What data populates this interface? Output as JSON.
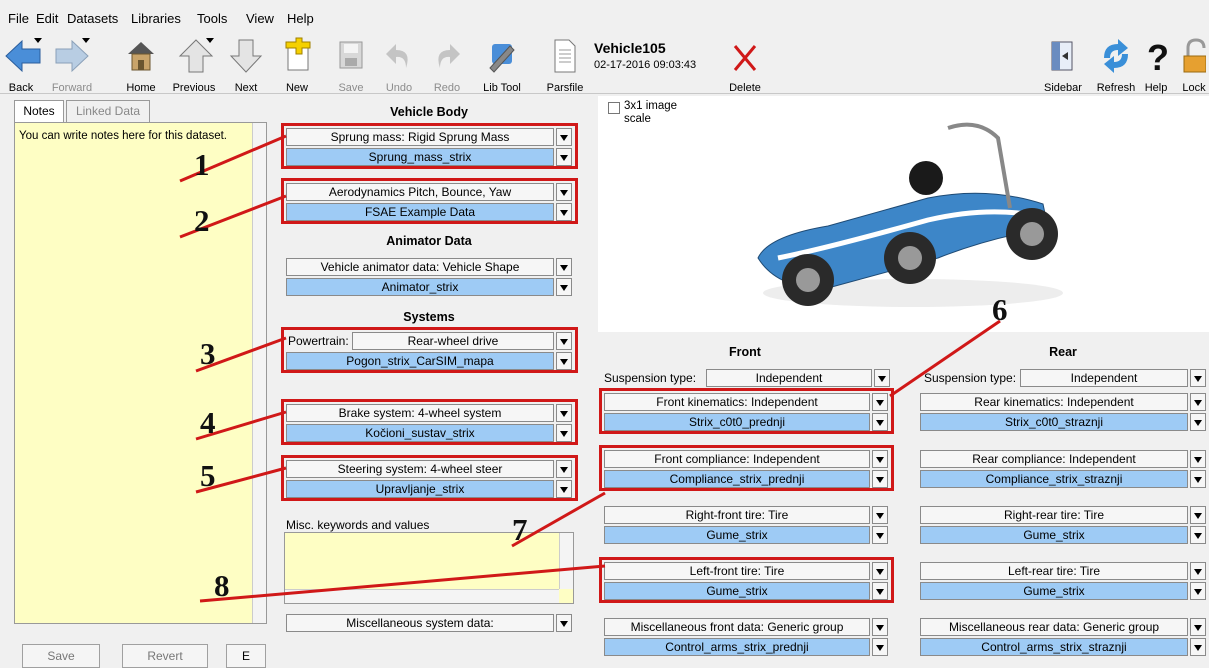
{
  "menu": [
    "File",
    "Edit",
    "Datasets",
    "Libraries",
    "Tools",
    "View",
    "Help"
  ],
  "toolbar": {
    "back": "Back",
    "forward": "Forward",
    "home": "Home",
    "previous": "Previous",
    "next": "Next",
    "new": "New",
    "save": "Save",
    "undo": "Undo",
    "redo": "Redo",
    "libtool": "Lib Tool",
    "parsfile": "Parsfile",
    "dataset_title": "Vehicle105",
    "dataset_date": "02-17-2016 09:03:43",
    "delete": "Delete",
    "sidebar": "Sidebar",
    "refresh": "Refresh",
    "help": "Help",
    "lock": "Lock"
  },
  "left": {
    "tab_notes": "Notes",
    "tab_linked": "Linked Data",
    "notes_text": "You can write notes here for this dataset.",
    "save": "Save",
    "revert": "Revert",
    "extra": "E"
  },
  "vehicle_body": {
    "title": "Vehicle Body",
    "sprung_label": "Sprung mass: Rigid Sprung Mass",
    "sprung_value": "Sprung_mass_strix",
    "aero_label": "Aerodynamics Pitch, Bounce, Yaw",
    "aero_value": "FSAE Example Data"
  },
  "animator": {
    "title": "Animator Data",
    "label": "Vehicle animator data: Vehicle Shape",
    "value": "Animator_strix"
  },
  "systems": {
    "title": "Systems",
    "powertrain_label": "Powertrain:",
    "powertrain_type": "Rear-wheel drive",
    "powertrain_value": "Pogon_strix_CarSIM_mapa",
    "brake_label": "Brake system: 4-wheel system",
    "brake_value": "Kočioni_sustav_strix",
    "steer_label": "Steering system: 4-wheel steer",
    "steer_value": "Upravljanje_strix",
    "misc_kw_label": "Misc. keywords and values",
    "misc_sys": "Miscellaneous system data:"
  },
  "image": {
    "checkbox_label": "3x1 image scale"
  },
  "front": {
    "title": "Front",
    "susp_label": "Suspension type:",
    "susp_type": "Independent",
    "kin_label": "Front kinematics: Independent",
    "kin_value": "Strix_c0t0_prednji",
    "comp_label": "Front compliance: Independent",
    "comp_value": "Compliance_strix_prednji",
    "rtire_label": "Right-front tire: Tire",
    "rtire_value": "Gume_strix",
    "ltire_label": "Left-front tire: Tire",
    "ltire_value": "Gume_strix",
    "misc_label": "Miscellaneous front data: Generic group",
    "misc_value": "Control_arms_strix_prednji"
  },
  "rear": {
    "title": "Rear",
    "susp_label": "Suspension type:",
    "susp_type": "Independent",
    "kin_label": "Rear kinematics: Independent",
    "kin_value": "Strix_c0t0_straznji",
    "comp_label": "Rear compliance: Independent",
    "comp_value": "Compliance_strix_straznji",
    "rtire_label": "Right-rear tire: Tire",
    "rtire_value": "Gume_strix",
    "ltire_label": "Left-rear tire: Tire",
    "ltire_value": "Gume_strix",
    "misc_label": "Miscellaneous rear data: Generic group",
    "misc_value": "Control_arms_strix_straznji"
  },
  "annotations": [
    "1",
    "2",
    "3",
    "4",
    "5",
    "6",
    "7",
    "8"
  ],
  "colors": {
    "highlight": "#d01818",
    "field_blue": "#9ecbf5",
    "notes_yellow": "#fefec4"
  }
}
